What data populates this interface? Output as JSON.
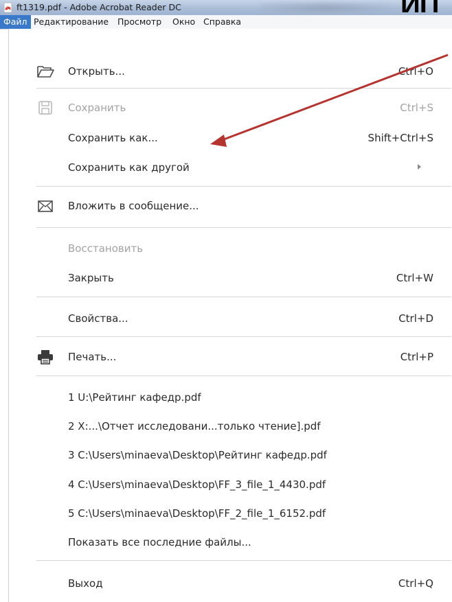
{
  "window": {
    "title": "ft1319.pdf - Adobe Acrobat Reader DC",
    "top_right_text": "ИП"
  },
  "menubar": {
    "items": [
      {
        "label": "Файл",
        "active": true
      },
      {
        "label": "Редактирование"
      },
      {
        "label": "Просмотр"
      },
      {
        "label": "Окно"
      },
      {
        "label": "Справка"
      }
    ]
  },
  "file_menu": {
    "open": {
      "label": "Открыть...",
      "shortcut": "Ctrl+O",
      "icon": "folder-open-icon"
    },
    "save": {
      "label": "Сохранить",
      "shortcut": "Ctrl+S",
      "icon": "floppy-disk-icon",
      "disabled": true
    },
    "save_as": {
      "label": "Сохранить как...",
      "shortcut": "Shift+Ctrl+S"
    },
    "save_as_other": {
      "label": "Сохранить как другой",
      "icon": "submenu-arrow-icon"
    },
    "attach_to_email": {
      "label": "Вложить в сообщение...",
      "icon": "envelope-icon"
    },
    "revert": {
      "label": "Восстановить",
      "disabled": true
    },
    "close": {
      "label": "Закрыть",
      "shortcut": "Ctrl+W"
    },
    "properties": {
      "label": "Свойства...",
      "shortcut": "Ctrl+D"
    },
    "print": {
      "label": "Печать...",
      "shortcut": "Ctrl+P",
      "icon": "printer-icon"
    },
    "recent_files": [
      "1 U:\\Рейтинг кафедр.pdf",
      "2 X:...\\Отчет исследовани...только чтение].pdf",
      "3 C:\\Users\\minaeva\\Desktop\\Рейтинг кафедр.pdf",
      "4 C:\\Users\\minaeva\\Desktop\\FF_3_file_1_4430.pdf",
      "5 C:\\Users\\minaeva\\Desktop\\FF_2_file_1_6152.pdf"
    ],
    "show_all_recent": {
      "label": "Показать все последние файлы..."
    },
    "exit": {
      "label": "Выход",
      "shortcut": "Ctrl+Q"
    }
  },
  "colors": {
    "menu_active_bg": "#3a78c9",
    "annotation_arrow": "#b5342f",
    "disabled_text": "#a3a3a3"
  }
}
